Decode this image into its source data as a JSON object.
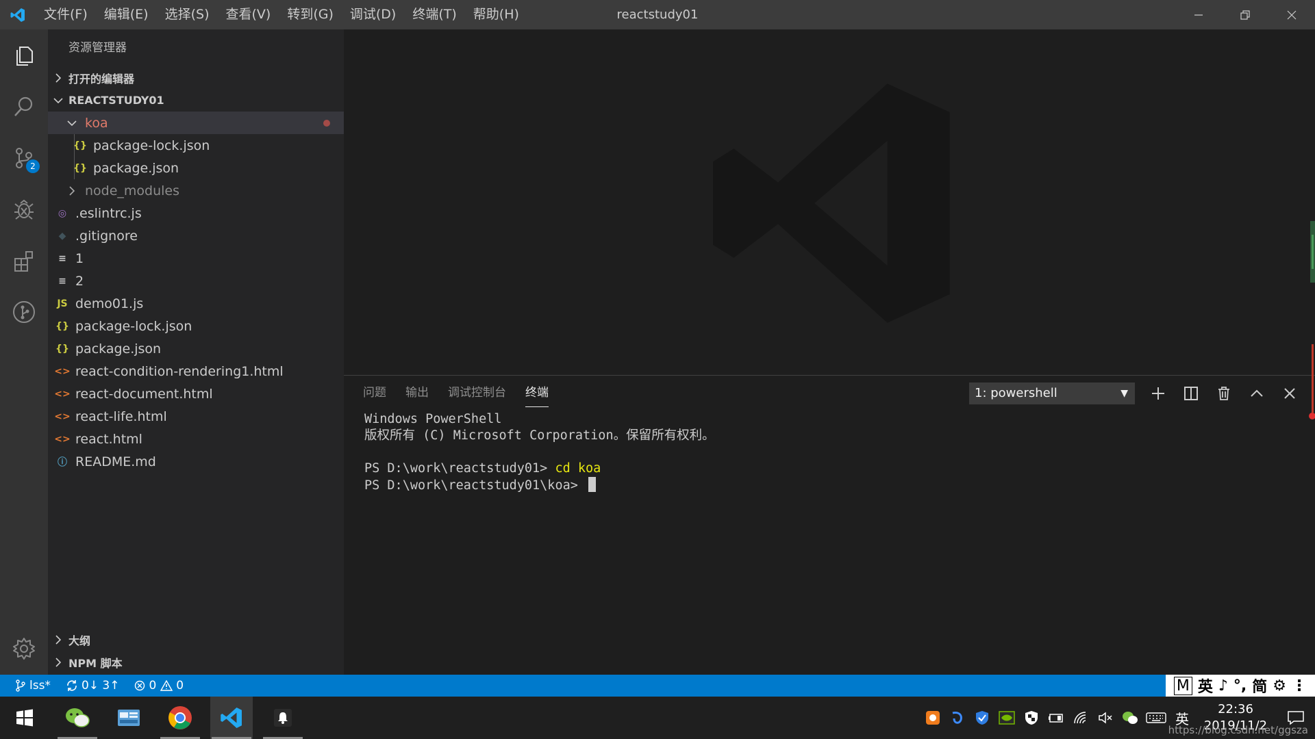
{
  "window": {
    "title": "reactstudy01",
    "menus": [
      "文件(F)",
      "编辑(E)",
      "选择(S)",
      "查看(V)",
      "转到(G)",
      "调试(D)",
      "终端(T)",
      "帮助(H)"
    ]
  },
  "activity_bar": {
    "scm_badge": "2"
  },
  "sidebar": {
    "title": "资源管理器",
    "open_editors": "打开的编辑器",
    "project": "REACTSTUDY01",
    "outline": "大纲",
    "npm_scripts": "NPM 脚本",
    "files": [
      {
        "name": "koa",
        "type": "folder-open",
        "icon": "chevron-down-icon",
        "glyph": "",
        "color": "#e07a6a"
      },
      {
        "name": "package-lock.json",
        "type": "json",
        "icon": "json-icon",
        "glyph": "{}",
        "color": "#cbcb41"
      },
      {
        "name": "package.json",
        "type": "json",
        "icon": "json-icon",
        "glyph": "{}",
        "color": "#cbcb41"
      },
      {
        "name": "node_modules",
        "type": "folder",
        "icon": "chevron-right-icon",
        "glyph": "",
        "color": "#8c8c8c"
      },
      {
        "name": ".eslintrc.js",
        "type": "eslint",
        "icon": "eslint-icon",
        "glyph": "◎",
        "color": "#a074c4"
      },
      {
        "name": ".gitignore",
        "type": "git",
        "icon": "git-icon",
        "glyph": "◆",
        "color": "#41535b"
      },
      {
        "name": "1",
        "type": "text",
        "icon": "text-file-icon",
        "glyph": "≡",
        "color": "#cccccc"
      },
      {
        "name": "2",
        "type": "text",
        "icon": "text-file-icon",
        "glyph": "≡",
        "color": "#cccccc"
      },
      {
        "name": "demo01.js",
        "type": "js",
        "icon": "js-icon",
        "glyph": "JS",
        "color": "#cbcb41"
      },
      {
        "name": "package-lock.json",
        "type": "json",
        "icon": "json-icon",
        "glyph": "{}",
        "color": "#cbcb41"
      },
      {
        "name": "package.json",
        "type": "json",
        "icon": "json-icon",
        "glyph": "{}",
        "color": "#cbcb41"
      },
      {
        "name": "react-condition-rendering1.html",
        "type": "html",
        "icon": "html-icon",
        "glyph": "<>",
        "color": "#e37933"
      },
      {
        "name": "react-document.html",
        "type": "html",
        "icon": "html-icon",
        "glyph": "<>",
        "color": "#e37933"
      },
      {
        "name": "react-life.html",
        "type": "html",
        "icon": "html-icon",
        "glyph": "<>",
        "color": "#e37933"
      },
      {
        "name": "react.html",
        "type": "html",
        "icon": "html-icon",
        "glyph": "<>",
        "color": "#e37933"
      },
      {
        "name": "README.md",
        "type": "info",
        "icon": "info-icon",
        "glyph": "ⓘ",
        "color": "#519aba"
      }
    ]
  },
  "panel": {
    "tabs": [
      "问题",
      "输出",
      "调试控制台",
      "终端"
    ],
    "active_tab": "终端",
    "terminal_select": "1: powershell",
    "terminal": {
      "line1": "Windows PowerShell",
      "line2": "版权所有 (C) Microsoft Corporation。保留所有权利。",
      "prompt1": "PS D:\\work\\reactstudy01> ",
      "cmd1": "cd koa",
      "prompt2": "PS D:\\work\\reactstudy01\\koa> "
    }
  },
  "statusbar": {
    "branch": "lss*",
    "sync": "0↓ 3↑",
    "errors": "0",
    "warnings": "0"
  },
  "ime": {
    "items": [
      "M",
      "英",
      "♪",
      "°,",
      "简",
      "⚙",
      "⋮"
    ]
  },
  "taskbar": {
    "time": "22:36",
    "date": "2019/11/2",
    "ime_lang": "英",
    "url": "https://blog.csdn.net/ggsza"
  },
  "colors": {
    "accent": "#007acc",
    "titlebar": "#3c3c3c",
    "sidebar": "#252526",
    "editor": "#1e1e1e"
  }
}
